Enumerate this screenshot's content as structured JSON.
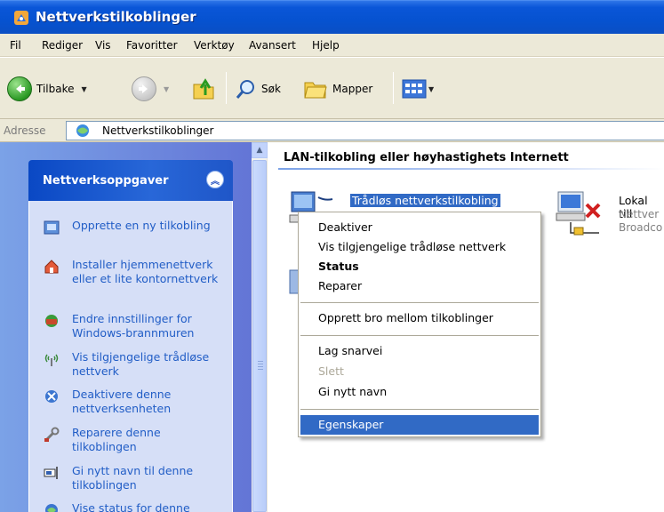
{
  "window": {
    "title": "Nettverkstilkoblinger"
  },
  "menu": [
    "Fil",
    "Rediger",
    "Vis",
    "Favoritter",
    "Verktøy",
    "Avansert",
    "Hjelp"
  ],
  "toolbar": {
    "back": "Tilbake",
    "search": "Søk",
    "folders": "Mapper"
  },
  "address": {
    "label": "Adresse",
    "value": "Nettverkstilkoblinger"
  },
  "taskpane": {
    "title": "Nettverksoppgaver",
    "tasks": [
      {
        "label": "Opprette en ny tilkobling",
        "icon": "new-connection-icon"
      },
      {
        "label": "Installer hjemmenettverk eller et lite kontornettverk",
        "icon": "home-network-icon"
      },
      {
        "label": "Endre innstillinger for Windows-brannmuren",
        "icon": "firewall-icon"
      },
      {
        "label": "Vis tilgjengelige trådløse nettverk",
        "icon": "wireless-icon"
      },
      {
        "label": "Deaktivere denne nettverksenheten",
        "icon": "disable-device-icon"
      },
      {
        "label": "Reparere denne tilkoblingen",
        "icon": "repair-icon"
      },
      {
        "label": "Gi nytt navn til denne tilkoblingen",
        "icon": "rename-icon"
      },
      {
        "label": "Vise status for denne tilkoblingen",
        "icon": "status-icon"
      }
    ]
  },
  "content": {
    "group_header": "LAN-tilkobling eller høyhastighets Internett",
    "connections": [
      {
        "name": "Trådløs nettverkstilkobling"
      },
      {
        "name": "Lokal till",
        "line1": "Nettver",
        "line2": "Broadco"
      }
    ]
  },
  "context_menu": {
    "items": [
      {
        "label": "Deaktiver"
      },
      {
        "label": "Vis tilgjengelige trådløse nettverk"
      },
      {
        "label": "Status"
      },
      {
        "label": "Reparer"
      },
      {
        "label": "Opprett bro mellom tilkoblinger"
      },
      {
        "label": "Lag snarvei"
      },
      {
        "label": "Slett"
      },
      {
        "label": "Gi nytt navn"
      },
      {
        "label": "Egenskaper"
      }
    ]
  }
}
